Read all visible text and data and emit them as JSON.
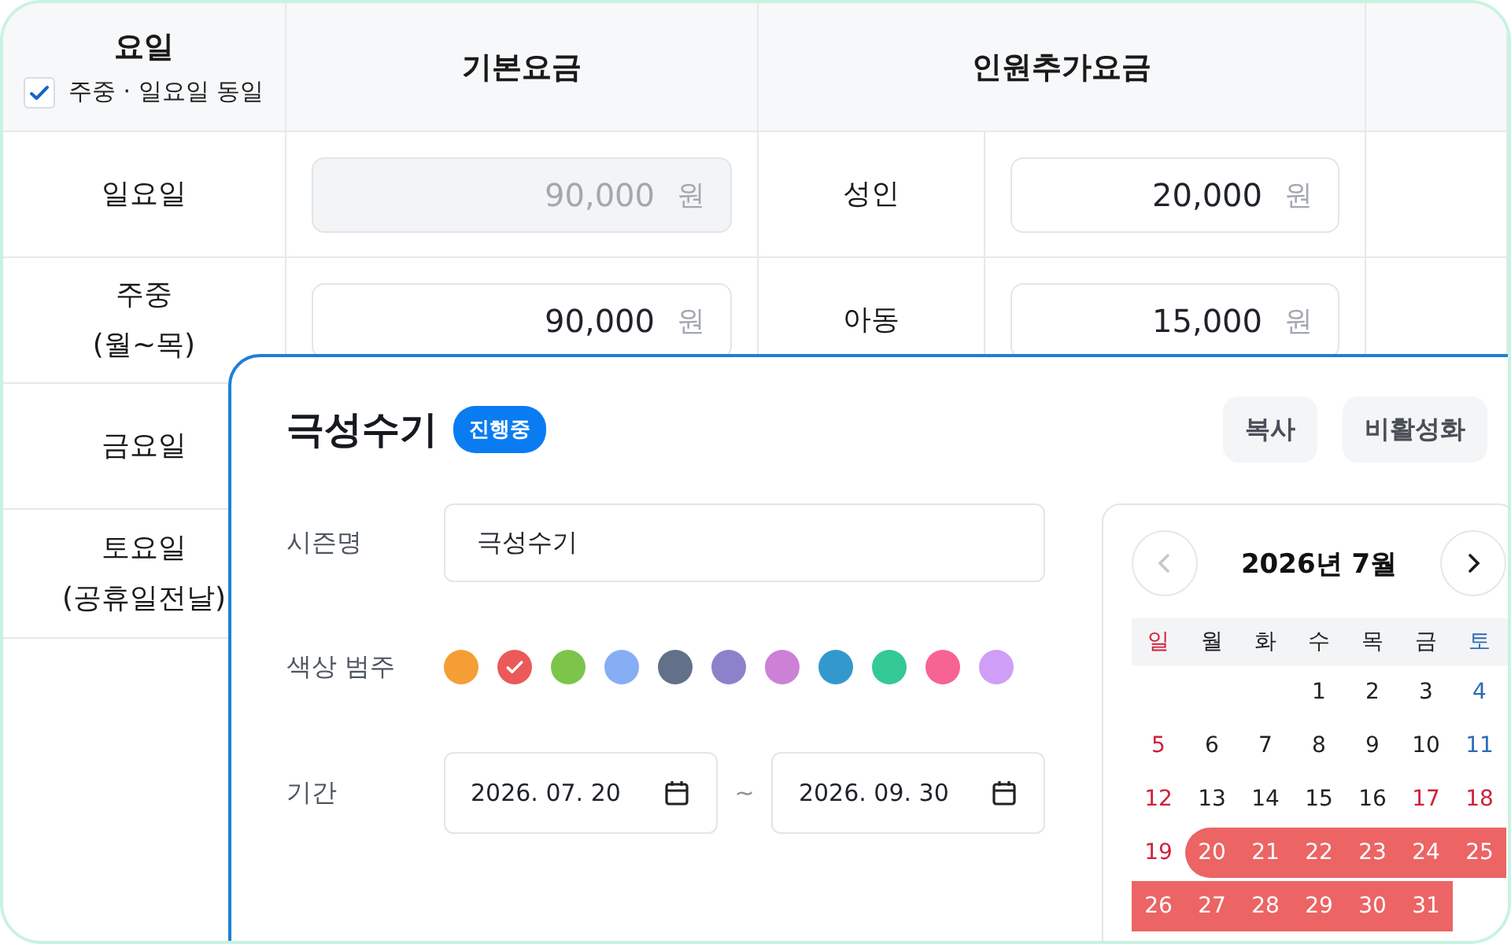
{
  "table": {
    "header": {
      "day_title": "요일",
      "same_checkbox": {
        "label": "주중 · 일요일 동일",
        "checked": true
      },
      "base_title": "기본요금",
      "extra_title": "인원추가요금"
    },
    "rows": [
      {
        "day_lines": [
          "일요일"
        ],
        "base": {
          "value": "90,000",
          "unit": "원",
          "disabled": true
        },
        "extra": {
          "label": "성인",
          "value": "20,000",
          "unit": "원"
        }
      },
      {
        "day_lines": [
          "주중",
          "(월~목)"
        ],
        "base": {
          "value": "90,000",
          "unit": "원",
          "disabled": false
        },
        "extra": {
          "label": "아동",
          "value": "15,000",
          "unit": "원"
        }
      },
      {
        "day_lines": [
          "금요일"
        ]
      },
      {
        "day_lines": [
          "토요일",
          "(공휴일전날)"
        ]
      }
    ]
  },
  "panel": {
    "title": "극성수기",
    "badge": "진행중",
    "buttons": [
      "복사",
      "비활성화"
    ],
    "name_label": "시즌명",
    "name_value": "극성수기",
    "color_label": "색상 범주",
    "swatches": [
      {
        "color": "#f59e35",
        "selected": false
      },
      {
        "color": "#ea5a5a",
        "selected": true
      },
      {
        "color": "#7dc44a",
        "selected": false
      },
      {
        "color": "#86aef5",
        "selected": false
      },
      {
        "color": "#627089",
        "selected": false
      },
      {
        "color": "#8c82c9",
        "selected": false
      },
      {
        "color": "#cc80d6",
        "selected": false
      },
      {
        "color": "#3399cc",
        "selected": false
      },
      {
        "color": "#33c995",
        "selected": false
      },
      {
        "color": "#f76392",
        "selected": false
      },
      {
        "color": "#cf9ef7",
        "selected": false
      }
    ],
    "period_label": "기간",
    "start_date": "2026. 07. 20",
    "separator": "~",
    "end_date": "2026. 09. 30",
    "calendar": {
      "title": "2026년 7월",
      "prev_disabled": true,
      "weekdays": [
        {
          "label": "일",
          "kind": "sunday"
        },
        {
          "label": "월",
          "kind": "weekday"
        },
        {
          "label": "화",
          "kind": "weekday"
        },
        {
          "label": "수",
          "kind": "weekday"
        },
        {
          "label": "목",
          "kind": "weekday"
        },
        {
          "label": "금",
          "kind": "weekday"
        },
        {
          "label": "토",
          "kind": "saturday"
        }
      ],
      "weeks": [
        {
          "days": [
            {
              "kind": "blank"
            },
            {
              "kind": "blank"
            },
            {
              "kind": "blank"
            },
            {
              "day": "1",
              "kind": "weekday",
              "selected": false
            },
            {
              "day": "2",
              "kind": "weekday",
              "selected": false
            },
            {
              "day": "3",
              "kind": "weekday",
              "selected": false
            },
            {
              "day": "4",
              "kind": "saturday",
              "selected": false
            }
          ]
        },
        {
          "days": [
            {
              "day": "5",
              "kind": "holiday",
              "selected": false
            },
            {
              "day": "6",
              "kind": "weekday",
              "selected": false
            },
            {
              "day": "7",
              "kind": "weekday",
              "selected": false
            },
            {
              "day": "8",
              "kind": "weekday",
              "selected": false
            },
            {
              "day": "9",
              "kind": "weekday",
              "selected": false
            },
            {
              "day": "10",
              "kind": "weekday",
              "selected": false
            },
            {
              "day": "11",
              "kind": "saturday",
              "selected": false
            }
          ]
        },
        {
          "days": [
            {
              "day": "12",
              "kind": "holiday",
              "selected": false
            },
            {
              "day": "13",
              "kind": "weekday",
              "selected": false
            },
            {
              "day": "14",
              "kind": "weekday",
              "selected": false
            },
            {
              "day": "15",
              "kind": "weekday",
              "selected": false
            },
            {
              "day": "16",
              "kind": "weekday",
              "selected": false
            },
            {
              "day": "17",
              "kind": "holiday",
              "selected": false
            },
            {
              "day": "18",
              "kind": "holiday",
              "selected": false
            }
          ]
        },
        {
          "days": [
            {
              "day": "19",
              "kind": "holiday",
              "selected": false
            },
            {
              "day": "20",
              "kind": "weekday",
              "selected": true
            },
            {
              "day": "21",
              "kind": "weekday",
              "selected": true
            },
            {
              "day": "22",
              "kind": "weekday",
              "selected": true
            },
            {
              "day": "23",
              "kind": "weekday",
              "selected": true
            },
            {
              "day": "24",
              "kind": "weekday",
              "selected": true
            },
            {
              "day": "25",
              "kind": "saturday",
              "selected": true
            }
          ]
        },
        {
          "days": [
            {
              "day": "26",
              "kind": "holiday",
              "selected": true
            },
            {
              "day": "27",
              "kind": "weekday",
              "selected": true
            },
            {
              "day": "28",
              "kind": "weekday",
              "selected": true
            },
            {
              "day": "29",
              "kind": "weekday",
              "selected": true
            },
            {
              "day": "30",
              "kind": "weekday",
              "selected": true
            },
            {
              "day": "31",
              "kind": "weekday",
              "selected": true
            }
          ]
        }
      ]
    }
  }
}
